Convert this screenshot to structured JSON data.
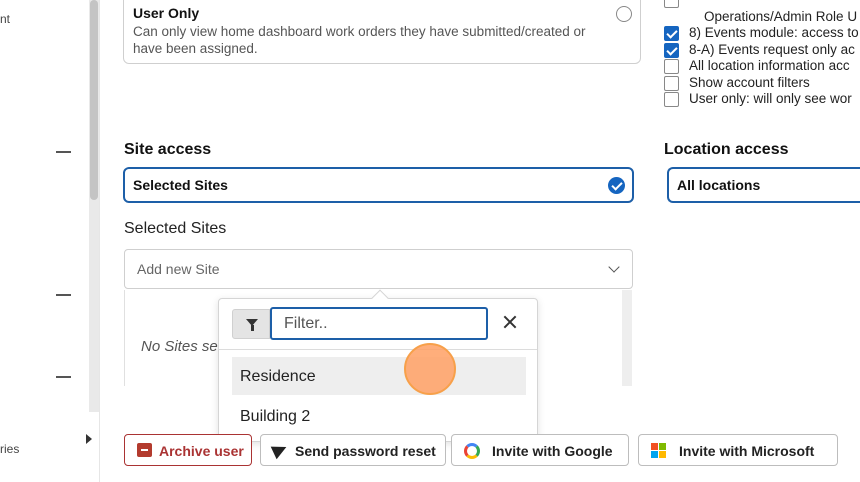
{
  "sidebar": {
    "partial_text_top": "nt",
    "partial_text_bottom": "ries"
  },
  "role_card": {
    "title": "User Only",
    "description": "Can only view home dashboard work orders they have submitted/created or have been assigned."
  },
  "permissions": [
    {
      "label": "",
      "checked": false
    },
    {
      "label": "Operations/Admin Role U",
      "checked": null
    },
    {
      "label": "8) Events module: access to",
      "checked": true
    },
    {
      "label": "8-A) Events request only ac",
      "checked": true
    },
    {
      "label": "All location information acc",
      "checked": false
    },
    {
      "label": "Show account filters",
      "checked": false
    },
    {
      "label": "User only: will only see wor",
      "checked": false
    }
  ],
  "site_access": {
    "label": "Site access",
    "value": "Selected Sites"
  },
  "location_access": {
    "label": "Location access",
    "value": "All locations"
  },
  "selected_sites": {
    "label": "Selected Sites",
    "add_placeholder": "Add new Site",
    "empty_text": "No Sites se"
  },
  "dropdown": {
    "filter_placeholder": "Filter..",
    "items": [
      "Residence",
      "Building 2"
    ],
    "highlighted_index": 0
  },
  "buttons": {
    "archive": "Archive user",
    "password_reset": "Send password reset",
    "invite_google": "Invite with Google",
    "invite_microsoft": "Invite with Microsoft"
  },
  "colors": {
    "accent": "#1565c0",
    "danger": "#a33333",
    "cursor": "#f7a04a"
  }
}
